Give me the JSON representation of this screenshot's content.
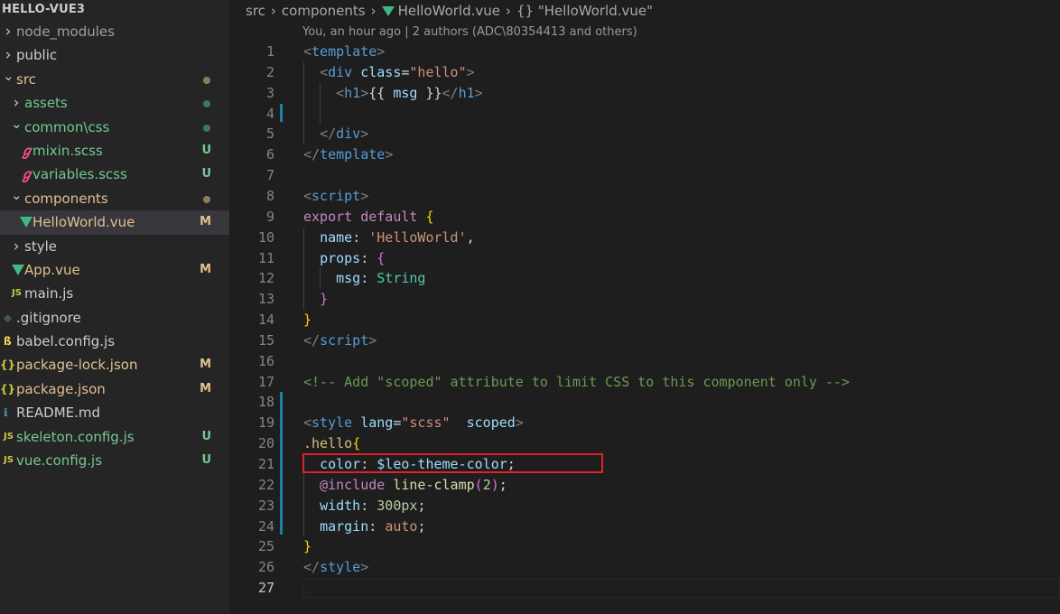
{
  "explorer": {
    "title": "HELLO-VUE3",
    "items": [
      {
        "name": "node_modules",
        "type": "folder",
        "depth": 0,
        "expanded": false,
        "status": "",
        "muted": true
      },
      {
        "name": "public",
        "type": "folder",
        "depth": 0,
        "expanded": false,
        "status": ""
      },
      {
        "name": "src",
        "type": "folder",
        "depth": 0,
        "expanded": true,
        "status": "dot",
        "dotColor": "#8b7d5c",
        "color": "#e2c08d"
      },
      {
        "name": "assets",
        "type": "folder",
        "depth": 1,
        "expanded": false,
        "status": "dot",
        "dotColor": "#3d7a57",
        "color": "#73c991"
      },
      {
        "name": "common\\css",
        "type": "folder",
        "depth": 1,
        "expanded": true,
        "status": "dot",
        "dotColor": "#3d7a57",
        "color": "#73c991"
      },
      {
        "name": "mixin.scss",
        "type": "file",
        "icon": "sass-icon",
        "depth": 2,
        "status": "U",
        "color": "#73c991",
        "statusColor": "#73c991"
      },
      {
        "name": "variables.scss",
        "type": "file",
        "icon": "sass-icon",
        "depth": 2,
        "status": "U",
        "color": "#73c991",
        "statusColor": "#73c991"
      },
      {
        "name": "components",
        "type": "folder",
        "depth": 1,
        "expanded": true,
        "status": "dot",
        "dotColor": "#8b7d5c",
        "color": "#e2c08d"
      },
      {
        "name": "HelloWorld.vue",
        "type": "file",
        "icon": "vue-icon",
        "depth": 2,
        "status": "M",
        "color": "#e2c08d",
        "statusColor": "#e2c08d",
        "selected": true
      },
      {
        "name": "style",
        "type": "folder",
        "depth": 1,
        "expanded": false,
        "status": ""
      },
      {
        "name": "App.vue",
        "type": "file",
        "icon": "vue-icon",
        "depth": 1,
        "status": "M",
        "color": "#e2c08d",
        "statusColor": "#e2c08d"
      },
      {
        "name": "main.js",
        "type": "file",
        "icon": "js-icon",
        "depth": 1,
        "status": ""
      },
      {
        "name": ".gitignore",
        "type": "file",
        "icon": "git-icon",
        "depth": 0,
        "status": ""
      },
      {
        "name": "babel.config.js",
        "type": "file",
        "icon": "babel-icon",
        "depth": 0,
        "status": ""
      },
      {
        "name": "package-lock.json",
        "type": "file",
        "icon": "json-icon",
        "depth": 0,
        "status": "M",
        "color": "#e2c08d",
        "statusColor": "#e2c08d"
      },
      {
        "name": "package.json",
        "type": "file",
        "icon": "json-icon",
        "depth": 0,
        "status": "M",
        "color": "#e2c08d",
        "statusColor": "#e2c08d"
      },
      {
        "name": "README.md",
        "type": "file",
        "icon": "info-icon",
        "depth": 0,
        "status": ""
      },
      {
        "name": "skeleton.config.js",
        "type": "file",
        "icon": "js-icon",
        "depth": 0,
        "status": "U",
        "color": "#73c991",
        "statusColor": "#73c991"
      },
      {
        "name": "vue.config.js",
        "type": "file",
        "icon": "js-icon",
        "depth": 0,
        "status": "U",
        "color": "#73c991",
        "statusColor": "#73c991"
      }
    ]
  },
  "breadcrumb": {
    "segments": [
      "src",
      "components",
      "HelloWorld.vue",
      "{} \"HelloWorld.vue\""
    ]
  },
  "codelens": "You, an hour ago | 2 authors (ADC\\80354413 and others)",
  "editor": {
    "active_line": 27,
    "lines": [
      [
        [
          "<",
          "tg"
        ],
        [
          "template",
          "tn"
        ],
        [
          ">",
          "tg"
        ]
      ],
      [
        [
          "  ",
          ""
        ],
        [
          "<",
          "tg"
        ],
        [
          "div",
          "tn"
        ],
        [
          " ",
          ""
        ],
        [
          "class",
          "at"
        ],
        [
          "=",
          "tx"
        ],
        [
          "\"hello\"",
          "sv"
        ],
        [
          ">",
          "tg"
        ]
      ],
      [
        [
          "    ",
          ""
        ],
        [
          "<",
          "tg"
        ],
        [
          "h1",
          "tn"
        ],
        [
          ">",
          "tg"
        ],
        [
          "{{ ",
          "tx"
        ],
        [
          "msg",
          "at"
        ],
        [
          " }}",
          "tx"
        ],
        [
          "</",
          "tg"
        ],
        [
          "h1",
          "tn"
        ],
        [
          ">",
          "tg"
        ]
      ],
      [
        [
          "",
          ""
        ]
      ],
      [
        [
          "  ",
          ""
        ],
        [
          "</",
          "tg"
        ],
        [
          "div",
          "tn"
        ],
        [
          ">",
          "tg"
        ]
      ],
      [
        [
          "</",
          "tg"
        ],
        [
          "template",
          "tn"
        ],
        [
          ">",
          "tg"
        ]
      ],
      [
        [
          "",
          ""
        ]
      ],
      [
        [
          "<",
          "tg"
        ],
        [
          "script",
          "tn"
        ],
        [
          ">",
          "tg"
        ]
      ],
      [
        [
          "export",
          "kw"
        ],
        [
          " ",
          ""
        ],
        [
          "default",
          "kw"
        ],
        [
          " ",
          ""
        ],
        [
          "{",
          "br"
        ]
      ],
      [
        [
          "  ",
          ""
        ],
        [
          "name",
          "pr"
        ],
        [
          ": ",
          "tx"
        ],
        [
          "'HelloWorld'",
          "sv"
        ],
        [
          ",",
          "tx"
        ]
      ],
      [
        [
          "  ",
          ""
        ],
        [
          "props",
          "pr"
        ],
        [
          ": ",
          "tx"
        ],
        [
          "{",
          "bp"
        ]
      ],
      [
        [
          "    ",
          ""
        ],
        [
          "msg",
          "pr"
        ],
        [
          ": ",
          "tx"
        ],
        [
          "String",
          "ty"
        ]
      ],
      [
        [
          "  ",
          ""
        ],
        [
          "}",
          "bp"
        ]
      ],
      [
        [
          "}",
          "br"
        ]
      ],
      [
        [
          "</",
          "tg"
        ],
        [
          "script",
          "tn"
        ],
        [
          ">",
          "tg"
        ]
      ],
      [
        [
          "",
          ""
        ]
      ],
      [
        [
          "<!-- Add \"scoped\" attribute to limit CSS to this component only -->",
          "cm"
        ]
      ],
      [
        [
          "",
          ""
        ]
      ],
      [
        [
          "<",
          "tg"
        ],
        [
          "style",
          "tn"
        ],
        [
          " ",
          ""
        ],
        [
          "lang",
          "at"
        ],
        [
          "=",
          "tx"
        ],
        [
          "\"scss\"",
          "sv"
        ],
        [
          "  ",
          ""
        ],
        [
          "scoped",
          "at"
        ],
        [
          ">",
          "tg"
        ]
      ],
      [
        [
          ".hello",
          "sel"
        ],
        [
          "{",
          "br"
        ]
      ],
      [
        [
          "  ",
          ""
        ],
        [
          "color",
          "pr"
        ],
        [
          ": ",
          "tx"
        ],
        [
          "$leo-theme-color",
          "at"
        ],
        [
          ";",
          "tx"
        ]
      ],
      [
        [
          "  ",
          ""
        ],
        [
          "@include",
          "kw"
        ],
        [
          " ",
          ""
        ],
        [
          "line-clamp",
          "fn"
        ],
        [
          "(",
          "bp"
        ],
        [
          "2",
          "nm"
        ],
        [
          ")",
          "bp"
        ],
        [
          ";",
          "tx"
        ]
      ],
      [
        [
          "  ",
          ""
        ],
        [
          "width",
          "pr"
        ],
        [
          ": ",
          "tx"
        ],
        [
          "300px",
          "nm"
        ],
        [
          ";",
          "tx"
        ]
      ],
      [
        [
          "  ",
          ""
        ],
        [
          "margin",
          "pr"
        ],
        [
          ": ",
          "tx"
        ],
        [
          "auto",
          "cv"
        ],
        [
          ";",
          "tx"
        ]
      ],
      [
        [
          "}",
          "br"
        ]
      ],
      [
        [
          "</",
          "tg"
        ],
        [
          "style",
          "tn"
        ],
        [
          ">",
          "tg"
        ]
      ],
      [
        [
          "",
          ""
        ]
      ]
    ]
  }
}
